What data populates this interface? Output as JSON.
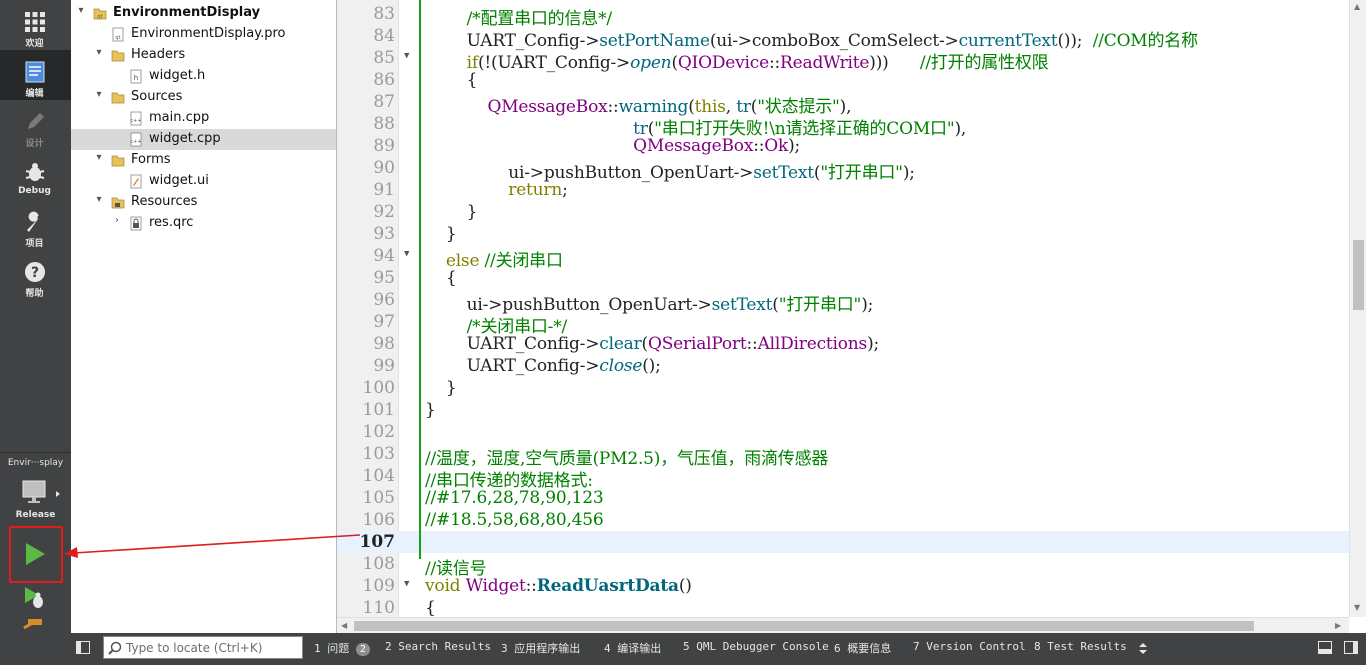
{
  "modebar": {
    "welcome": "欢迎",
    "edit": "编辑",
    "design": "设计",
    "debug": "Debug",
    "projects": "项目",
    "help": "帮助",
    "target_name": "Envir···splay",
    "build_config": "Release"
  },
  "tree": {
    "project": "EnvironmentDisplay",
    "pro_file": "EnvironmentDisplay.pro",
    "headers": "Headers",
    "widget_h": "widget.h",
    "sources": "Sources",
    "main_cpp": "main.cpp",
    "widget_cpp": "widget.cpp",
    "forms": "Forms",
    "widget_ui": "widget.ui",
    "resources": "Resources",
    "res_qrc": "res.qrc"
  },
  "editor": {
    "line_numbers": [
      "83",
      "84",
      "85",
      "86",
      "87",
      "88",
      "89",
      "90",
      "91",
      "92",
      "93",
      "94",
      "95",
      "96",
      "97",
      "98",
      "99",
      "100",
      "101",
      "102",
      "103",
      "104",
      "105",
      "106",
      "107",
      "108",
      "109",
      "110"
    ],
    "current_line": "107"
  },
  "code": {
    "l83": "/*配置串口的信息*/",
    "l84a": "UART_Config",
    "l84b": "setPortName",
    "l84c": "ui",
    "l84d": "comboBox_ComSelect",
    "l84e": "currentText",
    "l84f": "//COM的名称",
    "l85a": "if",
    "l85b": "UART_Config",
    "l85c": "open",
    "l85d": "QIODevice",
    "l85e": "ReadWrite",
    "l85f": "//打开的属性权限",
    "l87a": "QMessageBox",
    "l87b": "warning",
    "l87c": "this",
    "l87d": "tr",
    "l87e": "\"状态提示\"",
    "l88a": "tr",
    "l88b": "\"串口打开失败!\\n请选择正确的COM口\"",
    "l89a": "QMessageBox",
    "l89b": "Ok",
    "l90a": "ui",
    "l90b": "pushButton_OpenUart",
    "l90c": "setText",
    "l90d": "\"打开串口\"",
    "l91": "return",
    "l94a": "else",
    "l94b": "//关闭串口",
    "l96a": "ui",
    "l96b": "pushButton_OpenUart",
    "l96c": "setText",
    "l96d": "\"打开串口\"",
    "l97": "/*关闭串口-*/",
    "l98a": "UART_Config",
    "l98b": "clear",
    "l98c": "QSerialPort",
    "l98d": "AllDirections",
    "l99a": "UART_Config",
    "l99b": "close",
    "l103": "//温度，湿度,空气质量(PM2.5)，气压值，雨滴传感器",
    "l104": "//串口传递的数据格式:",
    "l105": "//#17.6,28,78,90,123",
    "l106": "//#18.5,58,68,80,456",
    "l108": "//读信号",
    "l109a": "void",
    "l109b": "Widget",
    "l109c": "ReadUasrtData"
  },
  "status": {
    "locate_placeholder": "Type to locate (Ctrl+K)",
    "tab1": "1 问题",
    "tab1_badge": "2",
    "tab2": "2 Search Results",
    "tab3": "3 应用程序输出",
    "tab4": "4 编译输出",
    "tab5": "5 QML Debugger Console",
    "tab6": "6 概要信息",
    "tab7": "7 Version Control",
    "tab8": "8 Test Results"
  }
}
